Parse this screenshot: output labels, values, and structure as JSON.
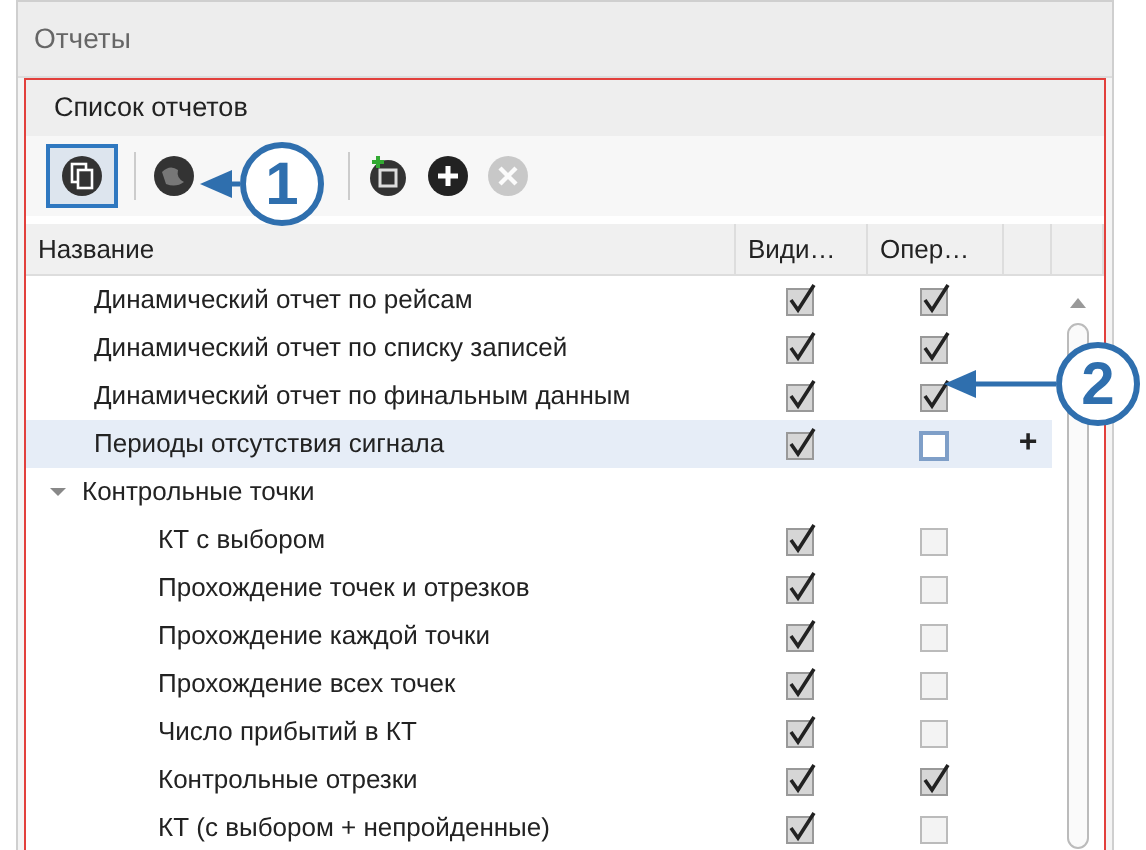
{
  "window": {
    "title": "Отчеты"
  },
  "panel": {
    "title": "Список отчетов"
  },
  "toolbar": [
    {
      "selected": true,
      "disabled": false
    },
    {
      "selected": false,
      "disabled": false
    },
    {
      "selected": false,
      "disabled": false
    },
    {
      "selected": false,
      "disabled": false
    },
    {
      "selected": false,
      "disabled": true
    }
  ],
  "table": {
    "columns": [
      "Название",
      "Види…",
      "Опер…"
    ],
    "rows": [
      {
        "name": "Динамический отчет по рейсам",
        "visible": true,
        "operational": true,
        "selected": false
      },
      {
        "name": "Динамический отчет по списку записей",
        "visible": true,
        "operational": true,
        "selected": false
      },
      {
        "name": "Динамический отчет по финальным данным",
        "visible": true,
        "operational": true,
        "selected": false
      },
      {
        "name": "Периоды отсутствия сигнала",
        "visible": true,
        "operational": false,
        "selected": true,
        "action": "+"
      },
      {
        "name": "Контрольные точки",
        "expanded": true,
        "selected": false,
        "children": [
          {
            "name": "КТ с выбором",
            "visible": true,
            "operational": false,
            "selected": false
          },
          {
            "name": "Прохождение точек и отрезков",
            "visible": true,
            "operational": false,
            "selected": false
          },
          {
            "name": "Прохождение каждой точки",
            "visible": true,
            "operational": false,
            "selected": false
          },
          {
            "name": "Прохождение всех точек",
            "visible": true,
            "operational": false,
            "selected": false
          },
          {
            "name": "Число прибытий в КТ",
            "visible": true,
            "operational": false,
            "selected": false
          },
          {
            "name": "Контрольные отрезки",
            "visible": true,
            "operational": true,
            "selected": false
          },
          {
            "name": "КТ (с выбором + непройденные)",
            "visible": true,
            "operational": false,
            "selected": false
          }
        ]
      }
    ]
  },
  "callouts": [
    {
      "label": "1"
    },
    {
      "label": "2"
    }
  ]
}
